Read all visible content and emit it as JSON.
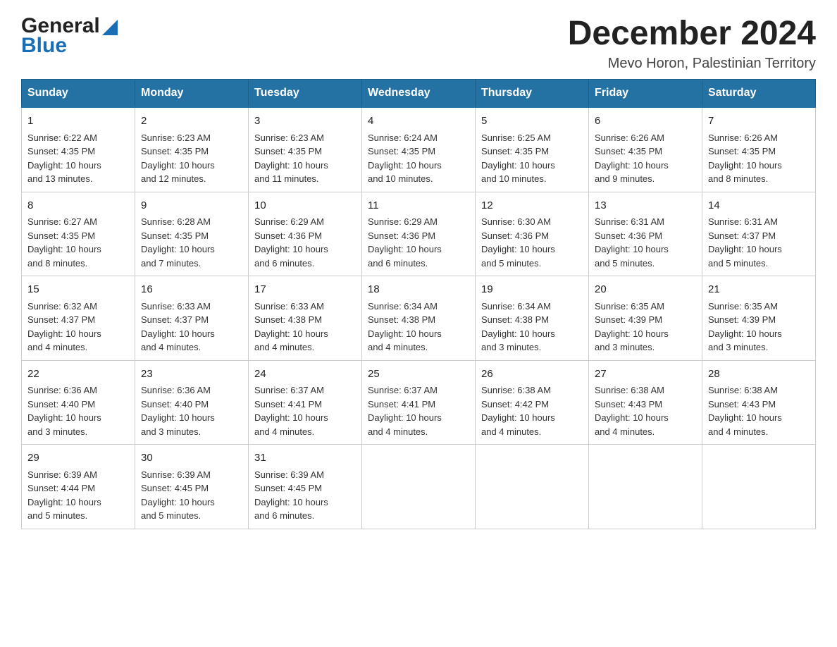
{
  "header": {
    "logo_general": "General",
    "logo_blue": "Blue",
    "month_title": "December 2024",
    "location": "Mevo Horon, Palestinian Territory"
  },
  "columns": [
    "Sunday",
    "Monday",
    "Tuesday",
    "Wednesday",
    "Thursday",
    "Friday",
    "Saturday"
  ],
  "weeks": [
    [
      {
        "day": "1",
        "sunrise": "6:22 AM",
        "sunset": "4:35 PM",
        "daylight": "10 hours and 13 minutes."
      },
      {
        "day": "2",
        "sunrise": "6:23 AM",
        "sunset": "4:35 PM",
        "daylight": "10 hours and 12 minutes."
      },
      {
        "day": "3",
        "sunrise": "6:23 AM",
        "sunset": "4:35 PM",
        "daylight": "10 hours and 11 minutes."
      },
      {
        "day": "4",
        "sunrise": "6:24 AM",
        "sunset": "4:35 PM",
        "daylight": "10 hours and 10 minutes."
      },
      {
        "day": "5",
        "sunrise": "6:25 AM",
        "sunset": "4:35 PM",
        "daylight": "10 hours and 10 minutes."
      },
      {
        "day": "6",
        "sunrise": "6:26 AM",
        "sunset": "4:35 PM",
        "daylight": "10 hours and 9 minutes."
      },
      {
        "day": "7",
        "sunrise": "6:26 AM",
        "sunset": "4:35 PM",
        "daylight": "10 hours and 8 minutes."
      }
    ],
    [
      {
        "day": "8",
        "sunrise": "6:27 AM",
        "sunset": "4:35 PM",
        "daylight": "10 hours and 8 minutes."
      },
      {
        "day": "9",
        "sunrise": "6:28 AM",
        "sunset": "4:35 PM",
        "daylight": "10 hours and 7 minutes."
      },
      {
        "day": "10",
        "sunrise": "6:29 AM",
        "sunset": "4:36 PM",
        "daylight": "10 hours and 6 minutes."
      },
      {
        "day": "11",
        "sunrise": "6:29 AM",
        "sunset": "4:36 PM",
        "daylight": "10 hours and 6 minutes."
      },
      {
        "day": "12",
        "sunrise": "6:30 AM",
        "sunset": "4:36 PM",
        "daylight": "10 hours and 5 minutes."
      },
      {
        "day": "13",
        "sunrise": "6:31 AM",
        "sunset": "4:36 PM",
        "daylight": "10 hours and 5 minutes."
      },
      {
        "day": "14",
        "sunrise": "6:31 AM",
        "sunset": "4:37 PM",
        "daylight": "10 hours and 5 minutes."
      }
    ],
    [
      {
        "day": "15",
        "sunrise": "6:32 AM",
        "sunset": "4:37 PM",
        "daylight": "10 hours and 4 minutes."
      },
      {
        "day": "16",
        "sunrise": "6:33 AM",
        "sunset": "4:37 PM",
        "daylight": "10 hours and 4 minutes."
      },
      {
        "day": "17",
        "sunrise": "6:33 AM",
        "sunset": "4:38 PM",
        "daylight": "10 hours and 4 minutes."
      },
      {
        "day": "18",
        "sunrise": "6:34 AM",
        "sunset": "4:38 PM",
        "daylight": "10 hours and 4 minutes."
      },
      {
        "day": "19",
        "sunrise": "6:34 AM",
        "sunset": "4:38 PM",
        "daylight": "10 hours and 3 minutes."
      },
      {
        "day": "20",
        "sunrise": "6:35 AM",
        "sunset": "4:39 PM",
        "daylight": "10 hours and 3 minutes."
      },
      {
        "day": "21",
        "sunrise": "6:35 AM",
        "sunset": "4:39 PM",
        "daylight": "10 hours and 3 minutes."
      }
    ],
    [
      {
        "day": "22",
        "sunrise": "6:36 AM",
        "sunset": "4:40 PM",
        "daylight": "10 hours and 3 minutes."
      },
      {
        "day": "23",
        "sunrise": "6:36 AM",
        "sunset": "4:40 PM",
        "daylight": "10 hours and 3 minutes."
      },
      {
        "day": "24",
        "sunrise": "6:37 AM",
        "sunset": "4:41 PM",
        "daylight": "10 hours and 4 minutes."
      },
      {
        "day": "25",
        "sunrise": "6:37 AM",
        "sunset": "4:41 PM",
        "daylight": "10 hours and 4 minutes."
      },
      {
        "day": "26",
        "sunrise": "6:38 AM",
        "sunset": "4:42 PM",
        "daylight": "10 hours and 4 minutes."
      },
      {
        "day": "27",
        "sunrise": "6:38 AM",
        "sunset": "4:43 PM",
        "daylight": "10 hours and 4 minutes."
      },
      {
        "day": "28",
        "sunrise": "6:38 AM",
        "sunset": "4:43 PM",
        "daylight": "10 hours and 4 minutes."
      }
    ],
    [
      {
        "day": "29",
        "sunrise": "6:39 AM",
        "sunset": "4:44 PM",
        "daylight": "10 hours and 5 minutes."
      },
      {
        "day": "30",
        "sunrise": "6:39 AM",
        "sunset": "4:45 PM",
        "daylight": "10 hours and 5 minutes."
      },
      {
        "day": "31",
        "sunrise": "6:39 AM",
        "sunset": "4:45 PM",
        "daylight": "10 hours and 6 minutes."
      },
      null,
      null,
      null,
      null
    ]
  ],
  "labels": {
    "sunrise": "Sunrise:",
    "sunset": "Sunset:",
    "daylight": "Daylight:"
  }
}
